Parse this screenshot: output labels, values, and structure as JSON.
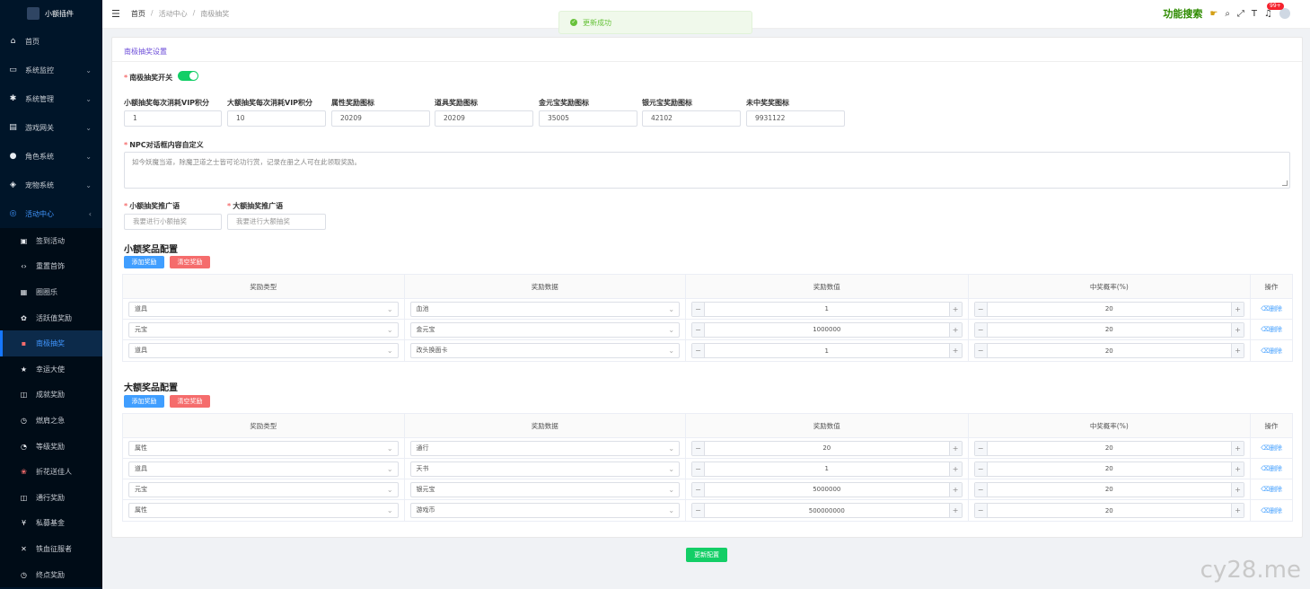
{
  "app": {
    "logo_text": "小额插件"
  },
  "sidebar": {
    "items": [
      {
        "label": "首页",
        "icon": "home-icon"
      },
      {
        "label": "系统监控",
        "icon": "monitor-icon"
      },
      {
        "label": "系统管理",
        "icon": "gear-icon"
      },
      {
        "label": "游戏网关",
        "icon": "gateway-icon"
      },
      {
        "label": "角色系统",
        "icon": "user-icon"
      },
      {
        "label": "宠物系统",
        "icon": "pet-icon"
      },
      {
        "label": "活动中心",
        "icon": "activity-icon"
      }
    ],
    "subitems": [
      "签到活动",
      "重置首饰",
      "圈圈乐",
      "活跃值奖励",
      "南极抽奖",
      "幸运大使",
      "成就奖励",
      "燃肩之急",
      "等级奖励",
      "折花送佳人",
      "通行奖励",
      "私募基金",
      "铁血征服者",
      "终点奖励"
    ]
  },
  "header": {
    "crumbs": [
      "首页",
      "活动中心",
      "南极抽奖"
    ],
    "function_search": "功能搜索",
    "badge": "99+"
  },
  "toast": {
    "text": "更新成功"
  },
  "form": {
    "card_title": "南极抽奖设置",
    "switch_label": "南极抽奖开关",
    "fields": [
      {
        "label": "小额抽奖每次消耗VIP积分",
        "value": "1"
      },
      {
        "label": "大额抽奖每次消耗VIP积分",
        "value": "10"
      },
      {
        "label": "属性奖励图标",
        "value": "20209"
      },
      {
        "label": "道具奖励图标",
        "value": "20209"
      },
      {
        "label": "金元宝奖励图标",
        "value": "35005"
      },
      {
        "label": "银元宝奖励图标",
        "value": "42102"
      },
      {
        "label": "未中奖奖图标",
        "value": "9931122"
      }
    ],
    "npc_label": "NPC对话框内容自定义",
    "npc_text": "如今妖魔当道，除魔卫道之士皆可论功行赏，记录在册之人可在此领取奖励。",
    "small_slogan_label": "小额抽奖推广语",
    "small_slogan_placeholder": "我要进行小额抽奖",
    "big_slogan_label": "大额抽奖推广语",
    "big_slogan_placeholder": "我要进行大额抽奖"
  },
  "small_prize": {
    "title": "小额奖品配置",
    "add_label": "添加奖励",
    "clear_label": "清空奖励",
    "headers": [
      "奖励类型",
      "奖励数据",
      "奖励数值",
      "中奖概率(%)",
      "操作"
    ],
    "rows": [
      {
        "type": "道具",
        "data": "血池",
        "value": "1",
        "rate": "20",
        "op": "删除"
      },
      {
        "type": "元宝",
        "data": "金元宝",
        "value": "1000000",
        "rate": "20",
        "op": "删除"
      },
      {
        "type": "道具",
        "data": "改头换面卡",
        "value": "1",
        "rate": "20",
        "op": "删除"
      }
    ]
  },
  "big_prize": {
    "title": "大额奖品配置",
    "add_label": "添加奖励",
    "clear_label": "清空奖励",
    "headers": [
      "奖励类型",
      "奖励数据",
      "奖励数值",
      "中奖概率(%)",
      "操作"
    ],
    "rows": [
      {
        "type": "属性",
        "data": "通行",
        "value": "20",
        "rate": "20",
        "op": "删除"
      },
      {
        "type": "道具",
        "data": "天书",
        "value": "1",
        "rate": "20",
        "op": "删除"
      },
      {
        "type": "元宝",
        "data": "银元宝",
        "value": "5000000",
        "rate": "20",
        "op": "删除"
      },
      {
        "type": "属性",
        "data": "游戏币",
        "value": "500000000",
        "rate": "20",
        "op": "删除"
      }
    ]
  },
  "save_label": "更新配置",
  "corner_mark": "cy28.me",
  "colors": {
    "accent": "#409eff",
    "success": "#13ce66",
    "danger": "#f56c6c",
    "sidebar": "#001529"
  }
}
